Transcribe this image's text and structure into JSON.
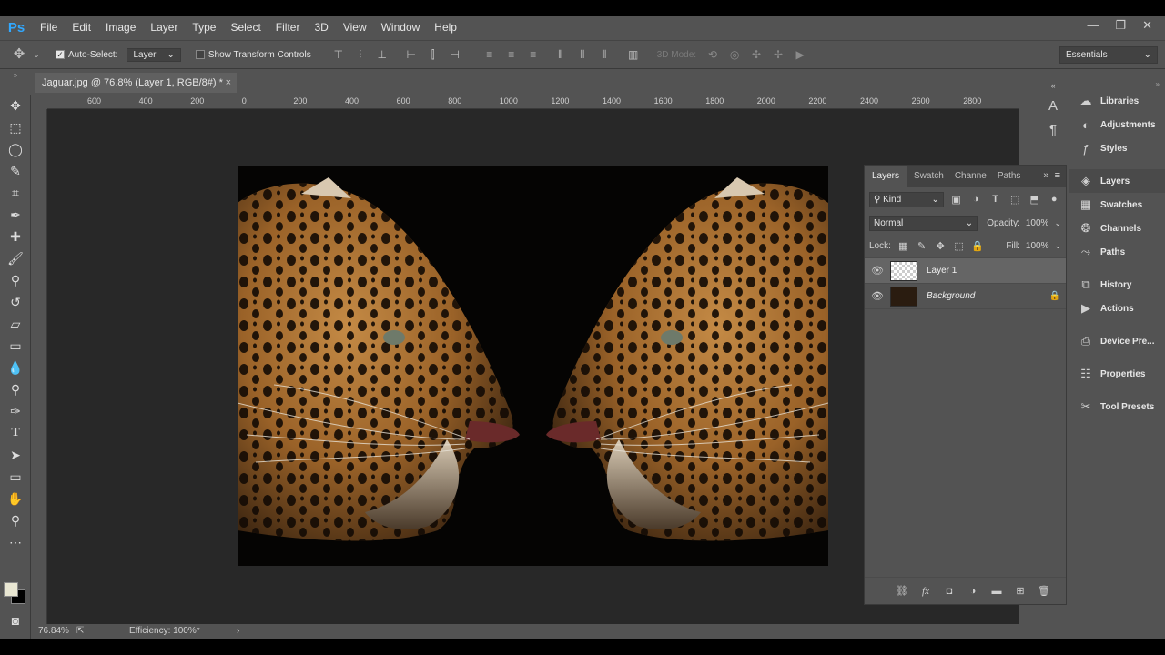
{
  "app": {
    "logo": "Ps"
  },
  "menu": [
    "File",
    "Edit",
    "Image",
    "Layer",
    "Type",
    "Select",
    "Filter",
    "3D",
    "View",
    "Window",
    "Help"
  ],
  "window_controls": {
    "minimize": "—",
    "restore": "❐",
    "close": "✕"
  },
  "options": {
    "auto_select_label": "Auto-Select:",
    "auto_select_checked": true,
    "auto_select_target": "Layer",
    "show_transform_label": "Show Transform Controls",
    "show_transform_checked": false,
    "mode_3d_label": "3D Mode:",
    "workspace": "Essentials"
  },
  "document": {
    "tab_title": "Jaguar.jpg @ 76.8% (Layer 1, RGB/8#) *",
    "zoom": "76.84%",
    "status": "Efficiency: 100%*"
  },
  "ruler": {
    "h_labels": [
      "600",
      "400",
      "200",
      "0",
      "200",
      "400",
      "600",
      "800",
      "1000",
      "1200",
      "1400",
      "1600",
      "1800",
      "2000",
      "2200",
      "2400",
      "2600",
      "2800"
    ]
  },
  "layers_panel": {
    "tabs": [
      "Layers",
      "Swatch",
      "Channe",
      "Paths"
    ],
    "filter_kind": "Kind",
    "blend_mode": "Normal",
    "opacity_label": "Opacity:",
    "opacity": "100%",
    "lock_label": "Lock:",
    "fill_label": "Fill:",
    "fill": "100%",
    "layers": [
      {
        "name": "Layer 1",
        "selected": true,
        "visible": true,
        "locked": false
      },
      {
        "name": "Background",
        "selected": false,
        "visible": true,
        "locked": true
      }
    ]
  },
  "dock": {
    "group1": [
      "Libraries",
      "Adjustments",
      "Styles"
    ],
    "group2": [
      "Layers",
      "Swatches",
      "Channels",
      "Paths"
    ],
    "group3": [
      "History",
      "Actions"
    ],
    "group4": [
      "Device Pre..."
    ],
    "group5": [
      "Properties"
    ],
    "group6": [
      "Tool Presets"
    ]
  },
  "colors": {
    "foreground": "#e8e6d2",
    "background": "#000000",
    "accent": "#31a8ff"
  }
}
